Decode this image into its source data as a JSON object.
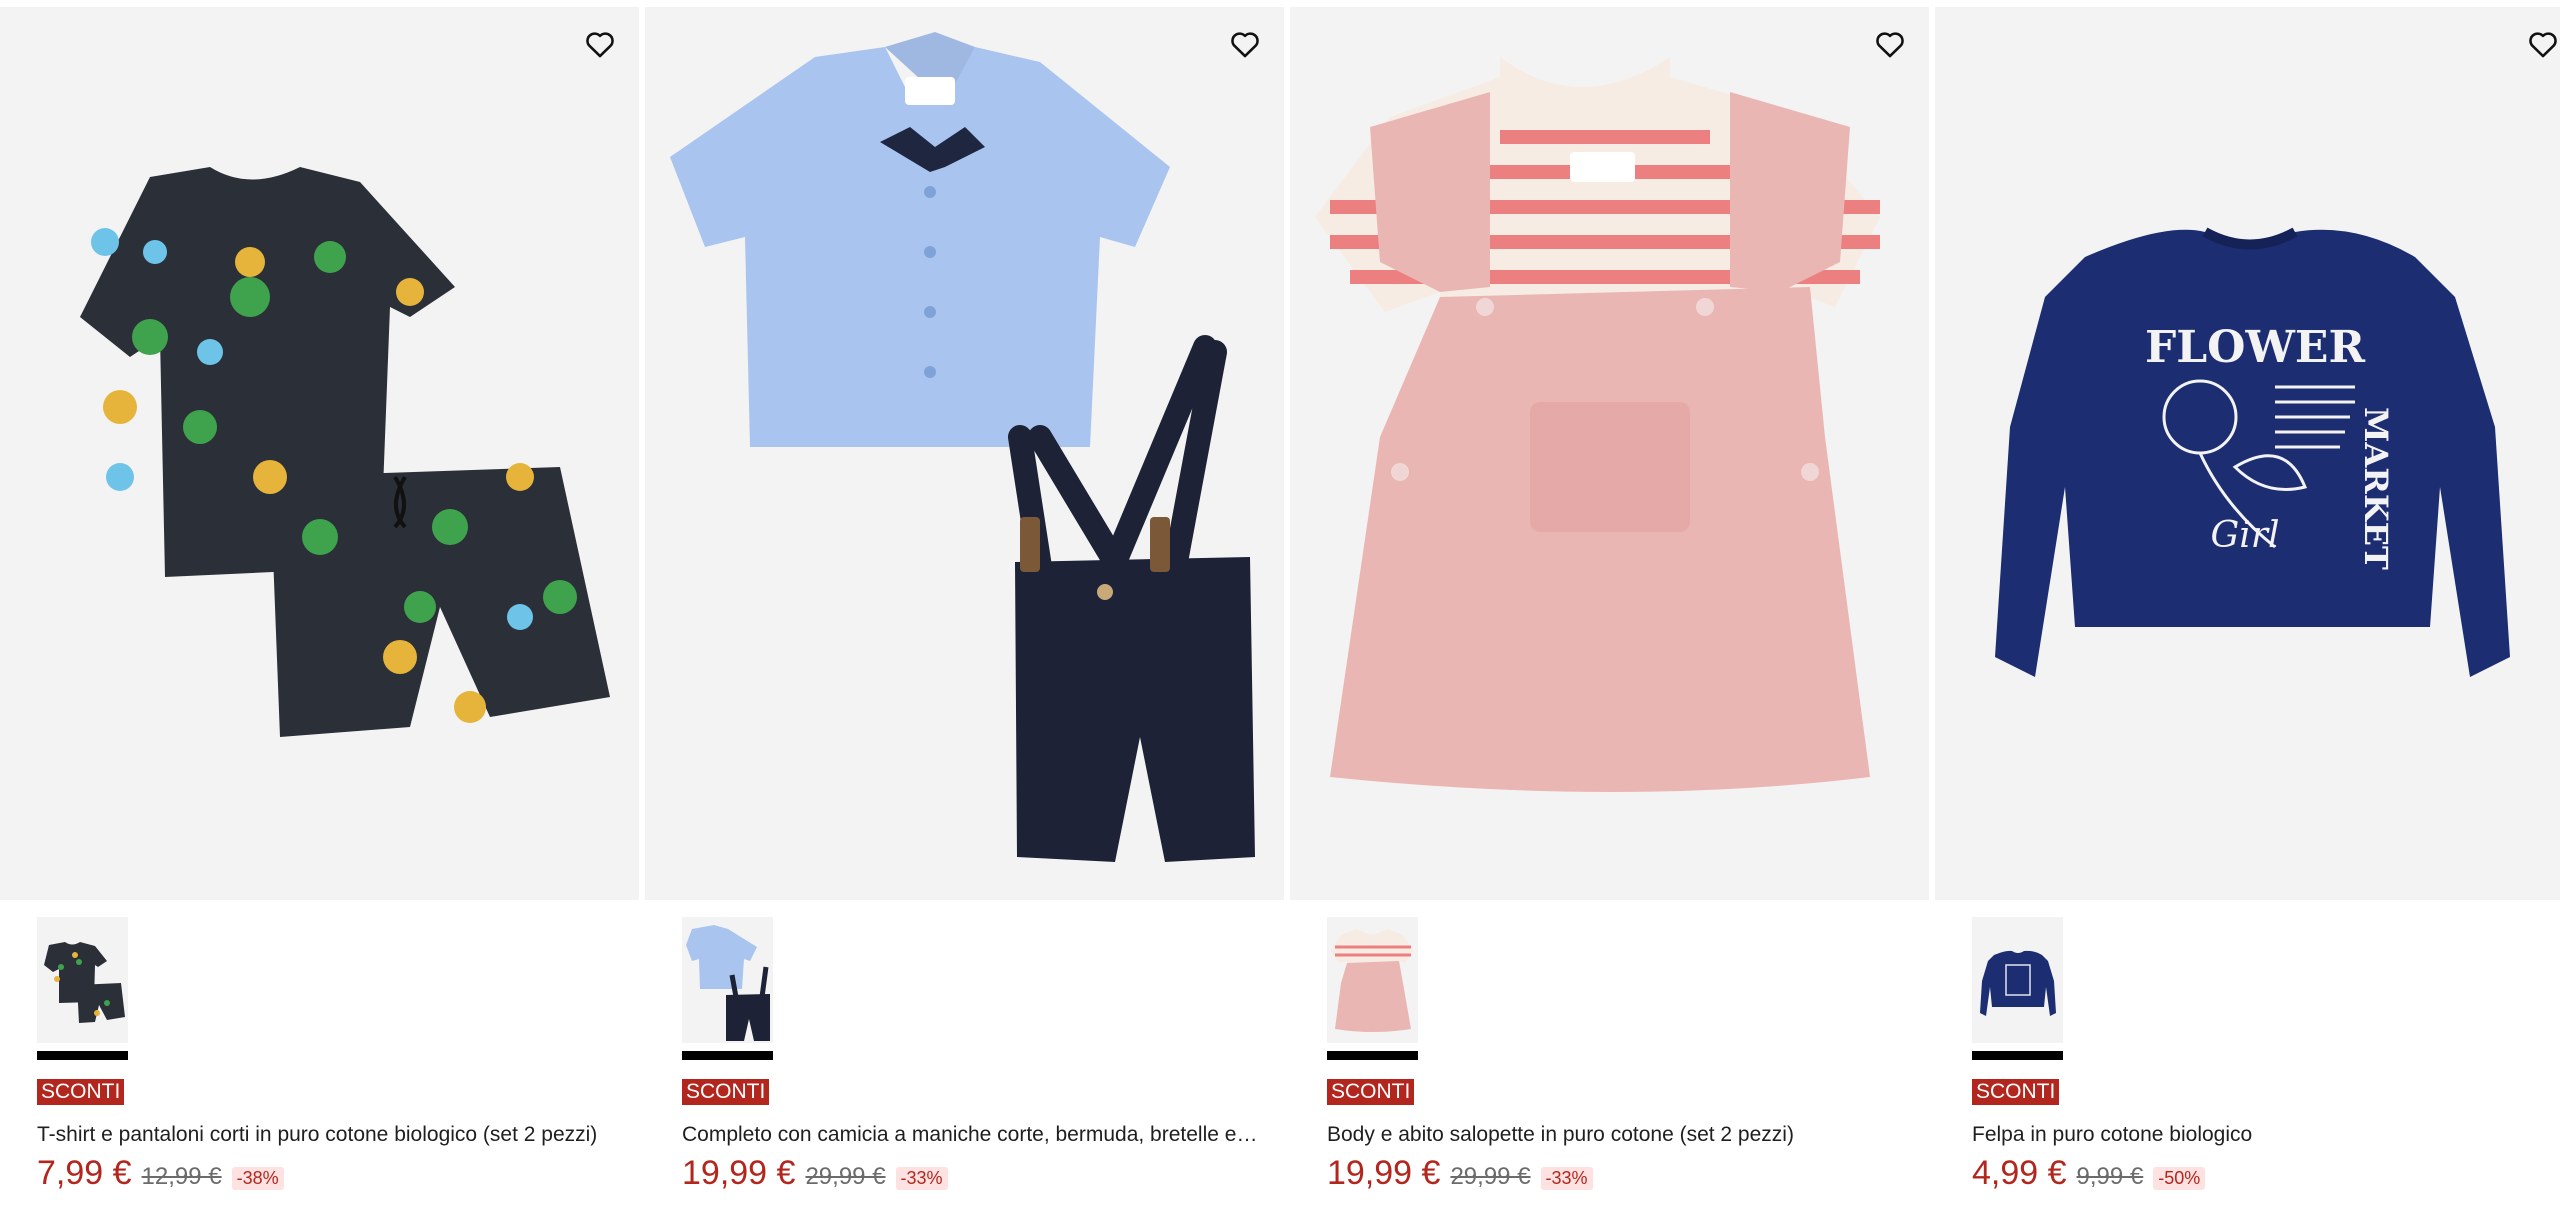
{
  "colors": {
    "accent": "#b3261e",
    "discount_bg": "#fde2e1",
    "image_bg": "#f3f3f3"
  },
  "products": [
    {
      "wishlist_icon": "heart-outline-icon",
      "badge": "SCONTI",
      "title": "T-shirt e pantaloni corti in puro cotone biologico (set 2 pezzi)",
      "price": "7,99 €",
      "old_price": "12,99 €",
      "discount": "-38%"
    },
    {
      "wishlist_icon": "heart-outline-icon",
      "badge": "SCONTI",
      "title": "Completo con camicia a maniche corte, bermuda, bretelle e …",
      "price": "19,99 €",
      "old_price": "29,99 €",
      "discount": "-33%"
    },
    {
      "wishlist_icon": "heart-outline-icon",
      "badge": "SCONTI",
      "title": "Body e abito salopette in puro cotone (set 2 pezzi)",
      "price": "19,99 €",
      "old_price": "29,99 €",
      "discount": "-33%"
    },
    {
      "wishlist_icon": "heart-outline-icon",
      "badge": "SCONTI",
      "title": "Felpa in puro cotone biologico",
      "price": "4,99 €",
      "old_price": "9,99 €",
      "discount": "-50%",
      "print_lines": [
        "FLOWER",
        "MARKET",
        "Girl"
      ]
    }
  ]
}
